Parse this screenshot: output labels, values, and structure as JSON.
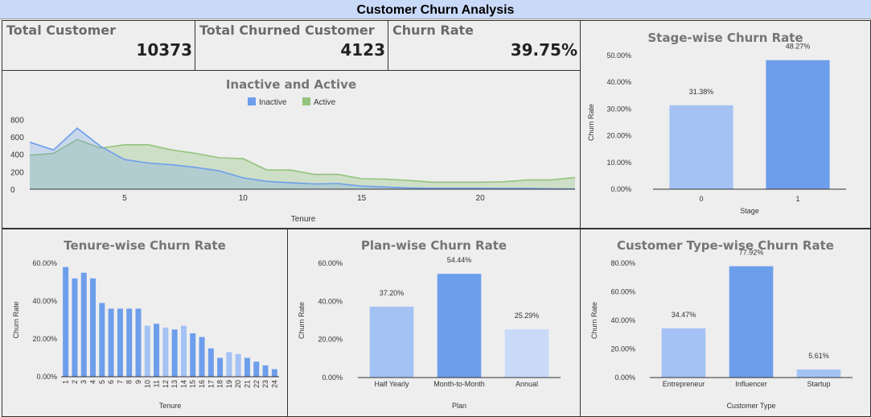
{
  "header": {
    "title": "Customer Churn Analysis"
  },
  "kpis": [
    {
      "label": "Total Customer",
      "value": "10373"
    },
    {
      "label": "Total Churned Customer",
      "value": "4123"
    },
    {
      "label": "Churn Rate",
      "value": "39.75%"
    }
  ],
  "colors": {
    "inactive": "#6d9eeb",
    "active": "#93c47d",
    "bar_dark": "#6d9eeb",
    "bar_light": "#a4c2f4",
    "bar_lighter": "#c9daf8"
  },
  "chart_data": [
    {
      "id": "inactive_active",
      "type": "area",
      "title": "Inactive and Active",
      "xlabel": "Tenure",
      "ylabel": "",
      "legend": "top-center",
      "x": [
        1,
        2,
        3,
        4,
        5,
        6,
        7,
        8,
        9,
        10,
        11,
        12,
        13,
        14,
        15,
        16,
        17,
        18,
        19,
        20,
        21,
        22,
        23,
        24
      ],
      "xticks": [
        "5",
        "10",
        "15",
        "20"
      ],
      "yticks": [
        "0",
        "200",
        "400",
        "600",
        "800"
      ],
      "ylim": [
        0,
        850
      ],
      "series": [
        {
          "name": "Inactive",
          "values": [
            540,
            450,
            700,
            490,
            340,
            300,
            280,
            250,
            210,
            130,
            90,
            75,
            60,
            65,
            35,
            25,
            15,
            10,
            10,
            10,
            8,
            8,
            5,
            3
          ]
        },
        {
          "name": "Active",
          "values": [
            390,
            410,
            570,
            470,
            510,
            510,
            450,
            410,
            360,
            350,
            220,
            220,
            170,
            170,
            120,
            115,
            100,
            80,
            80,
            80,
            85,
            105,
            105,
            135
          ]
        }
      ]
    },
    {
      "id": "stage",
      "type": "bar",
      "title": "Stage-wise Churn Rate",
      "xlabel": "Stage",
      "ylabel": "Churn Rate",
      "categories": [
        "0",
        "1"
      ],
      "values": [
        31.38,
        48.27
      ],
      "labels": [
        "31.38%",
        "48.27%"
      ],
      "yticks": [
        "0.00%",
        "10.00%",
        "20.00%",
        "30.00%",
        "40.00%",
        "50.00%"
      ],
      "ylim": [
        0,
        50
      ]
    },
    {
      "id": "tenure",
      "type": "bar",
      "title": "Tenure-wise Churn Rate",
      "xlabel": "Tenure",
      "ylabel": "Churn Rate",
      "categories": [
        "1",
        "2",
        "3",
        "4",
        "5",
        "6",
        "7",
        "8",
        "9",
        "10",
        "11",
        "12",
        "13",
        "14",
        "15",
        "16",
        "17",
        "18",
        "19",
        "20",
        "21",
        "22",
        "23",
        "24"
      ],
      "values": [
        58,
        52,
        55,
        52,
        39,
        36,
        36,
        36,
        36,
        27,
        28,
        26,
        25,
        27,
        23,
        21,
        15,
        10,
        13,
        12,
        10,
        8,
        6,
        4
      ],
      "yticks": [
        "0.00%",
        "20.00%",
        "40.00%",
        "60.00%"
      ],
      "ylim": [
        0,
        60
      ]
    },
    {
      "id": "plan",
      "type": "bar",
      "title": "Plan-wise Churn Rate",
      "xlabel": "Plan",
      "ylabel": "Churn Rate",
      "categories": [
        "Half Yearly",
        "Month-to-Month",
        "Annual"
      ],
      "values": [
        37.2,
        54.44,
        25.29
      ],
      "labels": [
        "37.20%",
        "54.44%",
        "25.29%"
      ],
      "yticks": [
        "0.00%",
        "20.00%",
        "40.00%",
        "60.00%"
      ],
      "ylim": [
        0,
        60
      ]
    },
    {
      "id": "custtype",
      "type": "bar",
      "title": "Customer Type-wise Churn Rate",
      "xlabel": "Customer Type",
      "ylabel": "Churn Rate",
      "categories": [
        "Entrepreneur",
        "Influencer",
        "Startup"
      ],
      "values": [
        34.47,
        77.92,
        5.61
      ],
      "labels": [
        "34.47%",
        "77.92%",
        "5.61%"
      ],
      "yticks": [
        "0.00%",
        "20.00%",
        "40.00%",
        "60.00%",
        "80.00%"
      ],
      "ylim": [
        0,
        80
      ]
    }
  ]
}
